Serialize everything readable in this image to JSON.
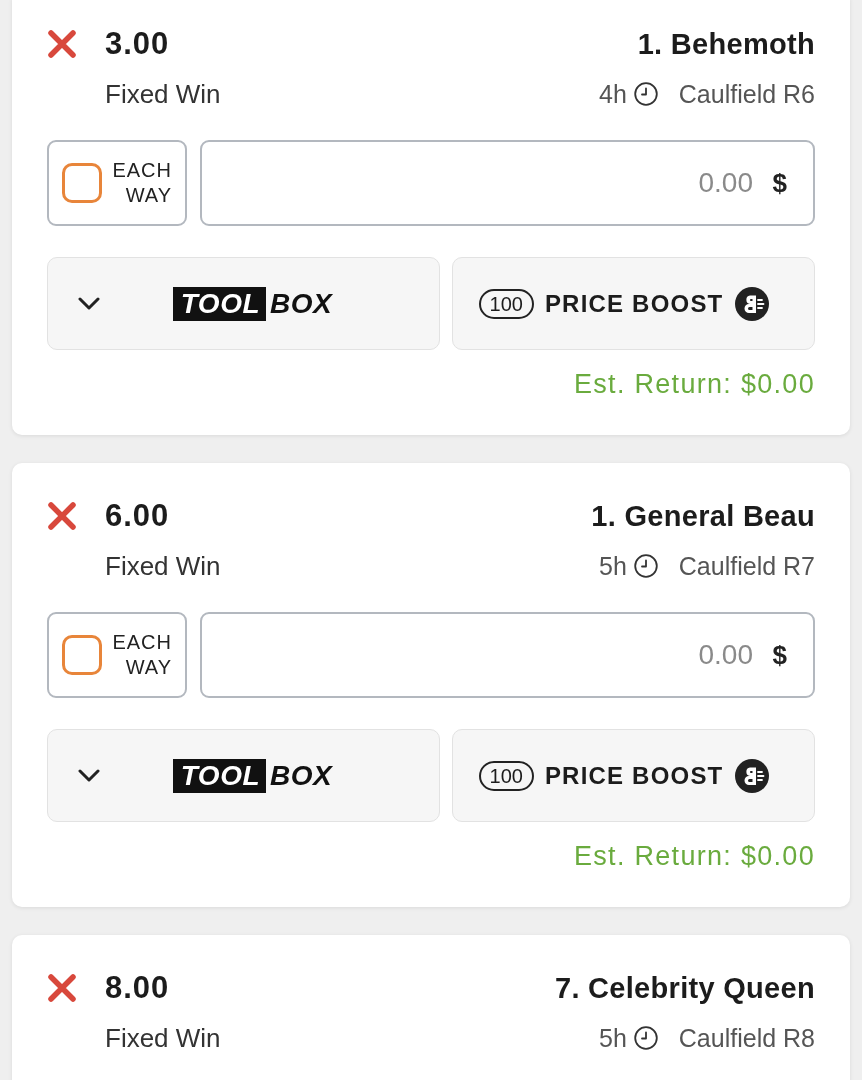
{
  "bets": [
    {
      "selection": "1. Behemoth",
      "race": "Caulfield R6",
      "time": "4h",
      "odds": "3.00",
      "bet_type": "Fixed Win",
      "stake": {
        "currency": "$",
        "placeholder": "0.00"
      },
      "each_way": {
        "label": "EACH WAY",
        "checked": false
      },
      "price_boost": {
        "label": "PRICE BOOST",
        "count": "100"
      },
      "toolbox": {
        "logo_dark": "TOOL",
        "logo_light": "BOX",
        "expanded": false
      },
      "est_return": "Est. Return: $0.00"
    },
    {
      "selection": "1. General Beau",
      "race": "Caulfield R7",
      "time": "5h",
      "odds": "6.00",
      "bet_type": "Fixed Win",
      "stake": {
        "currency": "$",
        "placeholder": "0.00"
      },
      "each_way": {
        "label": "EACH WAY",
        "checked": false
      },
      "price_boost": {
        "label": "PRICE BOOST",
        "count": "100"
      },
      "toolbox": {
        "logo_dark": "TOOL",
        "logo_light": "BOX",
        "expanded": false
      },
      "est_return": "Est. Return: $0.00"
    },
    {
      "selection": "7. Celebrity Queen",
      "race": "Caulfield R8",
      "time": "5h",
      "odds": "8.00",
      "bet_type": "Fixed Win"
    }
  ]
}
